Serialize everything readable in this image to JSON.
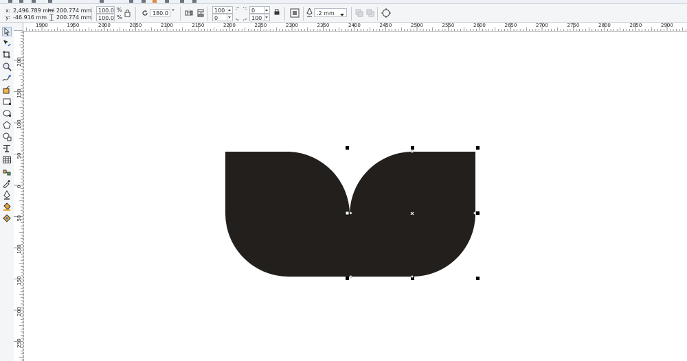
{
  "property_bar": {
    "x_label": "x:",
    "x_value": "2,496.789 mm",
    "y_label": "y:",
    "y_value": "-46.916 mm",
    "width_value": "200.774 mm",
    "height_value": "200.774 mm",
    "scale_x": "100.0",
    "scale_y": "100.0",
    "percent_x": "%",
    "percent_y": "%",
    "rotation_value": "180.0",
    "degree_symbol": "°",
    "corner_a": "100",
    "corner_b": "0",
    "corner_c": "0",
    "corner_d": "100",
    "outline_width": ".2 mm"
  },
  "ruler_h": {
    "labels": [
      "1900",
      "1950",
      "2000",
      "2050",
      "2100",
      "2150",
      "2200",
      "2250",
      "2300",
      "2350",
      "2400",
      "2450",
      "2500",
      "2550",
      "2600",
      "2650",
      "2700",
      "2750",
      "2800",
      "2850",
      "2900"
    ]
  },
  "ruler_v": {
    "labels": [
      "200",
      "150",
      "100",
      "50",
      "0",
      "50",
      "100",
      "150",
      "200",
      "250"
    ]
  },
  "toolbox": {
    "tools": [
      "pick-tool",
      "shape-tool",
      "crop-tool",
      "zoom-tool",
      "freehand-tool",
      "smart-fill-tool",
      "rectangle-tool",
      "ellipse-tool",
      "polygon-tool",
      "basic-shapes-tool",
      "text-tool",
      "table-tool",
      "dimension-tool",
      "connector-tool",
      "eyedropper-tool",
      "outline-pen-tool",
      "fill-tool",
      "interactive-fill-tool"
    ]
  },
  "colors": {
    "shape_fill": "#221f1c",
    "ui_bg": "#f4f5f7"
  }
}
